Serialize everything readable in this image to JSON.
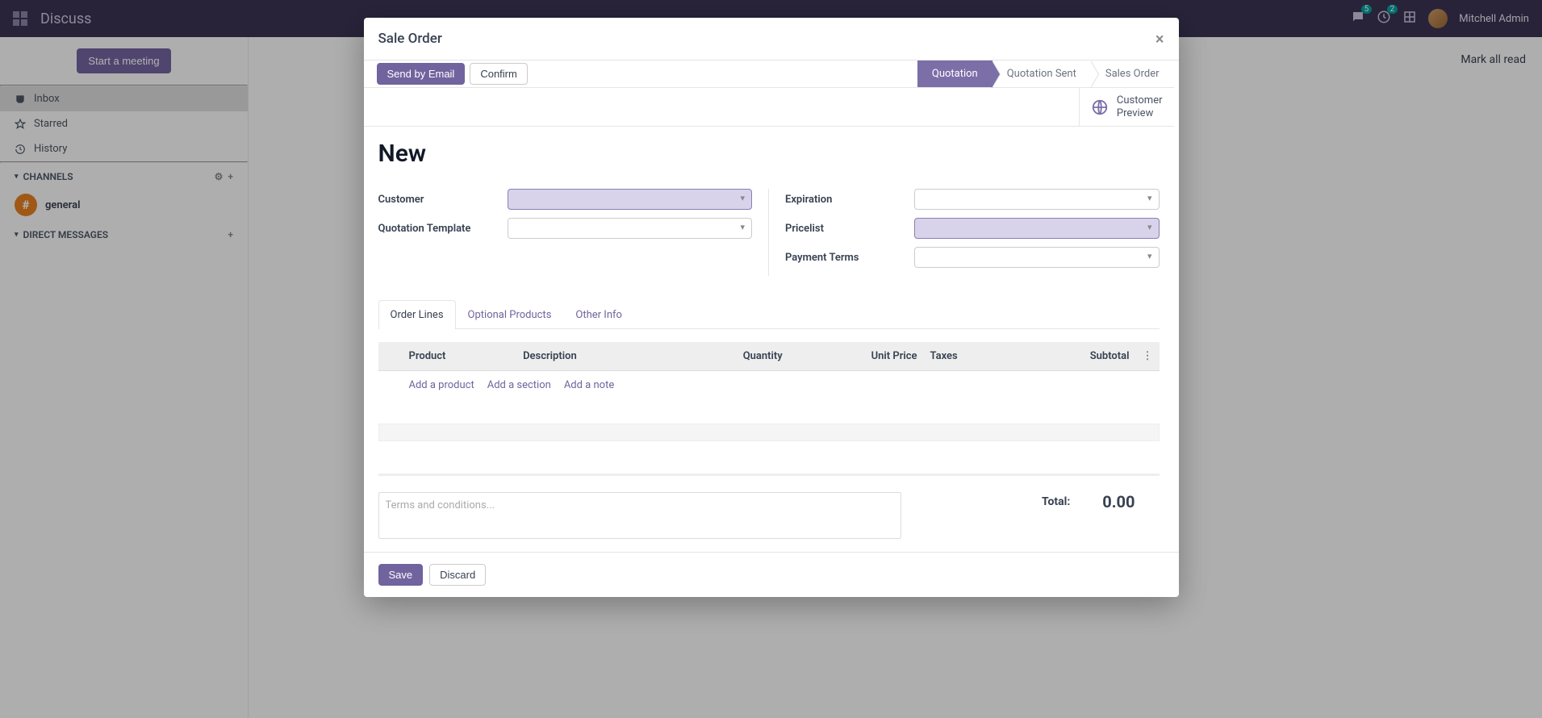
{
  "navbar": {
    "app_title": "Discuss",
    "messages_count": "5",
    "activities_count": "2",
    "username": "Mitchell Admin"
  },
  "bg_page": {
    "start_meeting": "Start a meeting",
    "mark_all_read": "Mark all read",
    "nav": {
      "inbox": "Inbox",
      "starred": "Starred",
      "history": "History"
    },
    "channels_heading": "CHANNELS",
    "channel_general": "general",
    "dm_heading": "DIRECT MESSAGES"
  },
  "modal": {
    "title": "Sale Order",
    "send_by_email": "Send by Email",
    "confirm": "Confirm",
    "stages": {
      "quotation": "Quotation",
      "quotation_sent": "Quotation Sent",
      "sales_order": "Sales Order"
    },
    "customer_preview_l1": "Customer",
    "customer_preview_l2": "Preview",
    "form_title": "New",
    "labels": {
      "customer": "Customer",
      "quotation_template": "Quotation Template",
      "expiration": "Expiration",
      "pricelist": "Pricelist",
      "payment_terms": "Payment Terms"
    },
    "tabs": {
      "order_lines": "Order Lines",
      "optional_products": "Optional Products",
      "other_info": "Other Info"
    },
    "columns": {
      "product": "Product",
      "description": "Description",
      "quantity": "Quantity",
      "unit_price": "Unit Price",
      "taxes": "Taxes",
      "subtotal": "Subtotal"
    },
    "line_actions": {
      "add_product": "Add a product",
      "add_section": "Add a section",
      "add_note": "Add a note"
    },
    "terms_placeholder": "Terms and conditions...",
    "total_label": "Total:",
    "total_value": "0.00",
    "save": "Save",
    "discard": "Discard"
  }
}
